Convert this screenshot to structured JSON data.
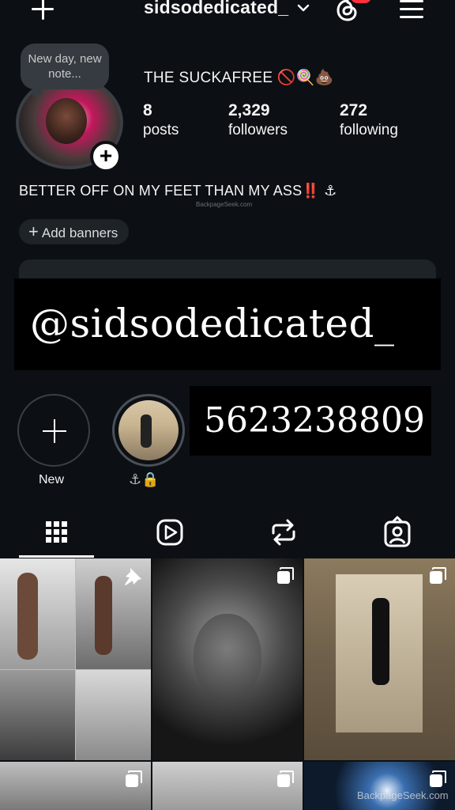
{
  "header": {
    "username": "sidsodedicated_",
    "icons": [
      "plus-icon",
      "chevron-down-icon",
      "threads-icon",
      "menu-icon"
    ]
  },
  "profile": {
    "note": "New day, new note...",
    "full_name": "THE SUCKAFREE 🚫🍭💩",
    "stats": [
      {
        "value": "8",
        "label": "posts"
      },
      {
        "value": "2,329",
        "label": "followers"
      },
      {
        "value": "272",
        "label": "following"
      }
    ],
    "bio": "BETTER OFF ON MY FEET THAN MY ASS‼️ ⚓",
    "watermark_small": "BackpageSeek.com",
    "add_banners": "Add banners"
  },
  "overlays": {
    "handle": "@sidsodedicated_",
    "phone": "5623238809"
  },
  "highlights": [
    {
      "label": "New"
    },
    {
      "label": "⚓🔒"
    }
  ],
  "tabs": [
    "grid-icon",
    "reels-icon",
    "reposts-icon",
    "tagged-icon"
  ],
  "colors": {
    "background": "#0c1014",
    "surface": "#1e2328",
    "badge": "#ff3040"
  },
  "watermark": "BackpageSeek.com"
}
